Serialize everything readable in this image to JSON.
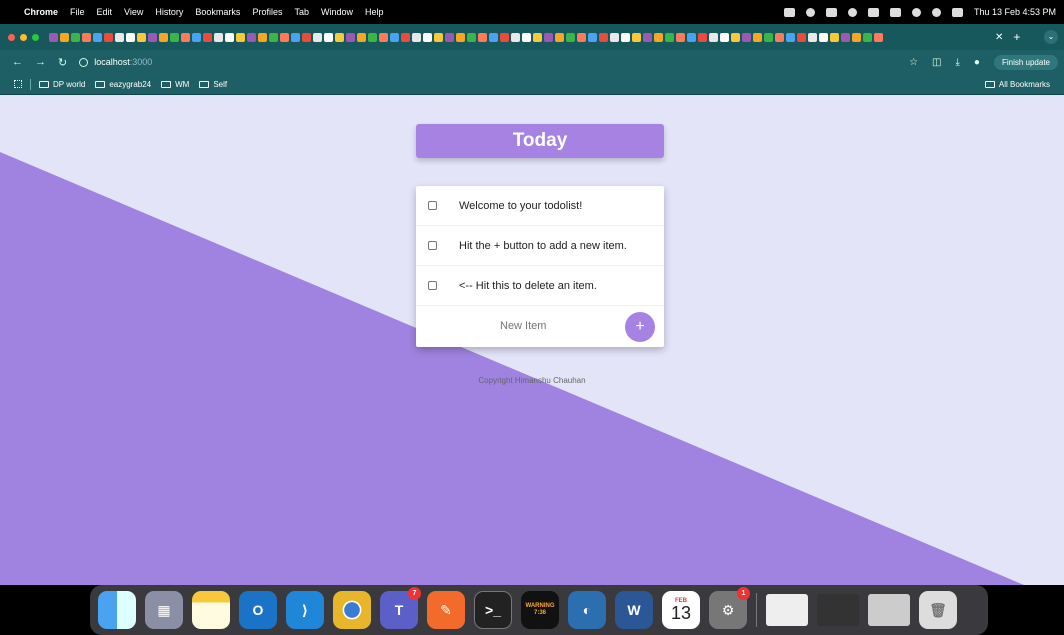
{
  "menubar": {
    "app": "Chrome",
    "items": [
      "File",
      "Edit",
      "View",
      "History",
      "Bookmarks",
      "Profiles",
      "Tab",
      "Window",
      "Help"
    ],
    "clock": "Thu 13 Feb 4:53 PM"
  },
  "browser": {
    "url_host": "localhost",
    "url_port": ":3000",
    "finish_update": "Finish update",
    "bookmarks": [
      "DP world",
      "eazygrab24",
      "WM",
      "Self"
    ],
    "all_bookmarks": "All Bookmarks"
  },
  "todo": {
    "heading": "Today",
    "items": [
      "Welcome to your todolist!",
      "Hit the + button to add a new item.",
      "<-- Hit this to delete an item."
    ],
    "new_item_placeholder": "New Item",
    "add_label": "+",
    "footer": "Copyright Himanshu Chauhan"
  },
  "dock": {
    "apps": [
      "finder-icon",
      "launchpad-icon",
      "notes-icon",
      "outlook-icon",
      "vscode-icon",
      "chrome-icon",
      "teams-icon",
      "postman-icon",
      "terminal-icon",
      "console-icon",
      "sequel-ace-icon",
      "word-icon",
      "calendar-icon",
      "system-settings-icon",
      "trash-icon"
    ],
    "teams_badge": "7",
    "settings_badge": "1",
    "calendar_month": "FEB",
    "calendar_day": "13",
    "console_text": "WARNING\n7:36"
  },
  "colors": {
    "accent": "#a683e3",
    "page_bg": "#e4e4f9",
    "browser_frame": "#1d5f64"
  }
}
